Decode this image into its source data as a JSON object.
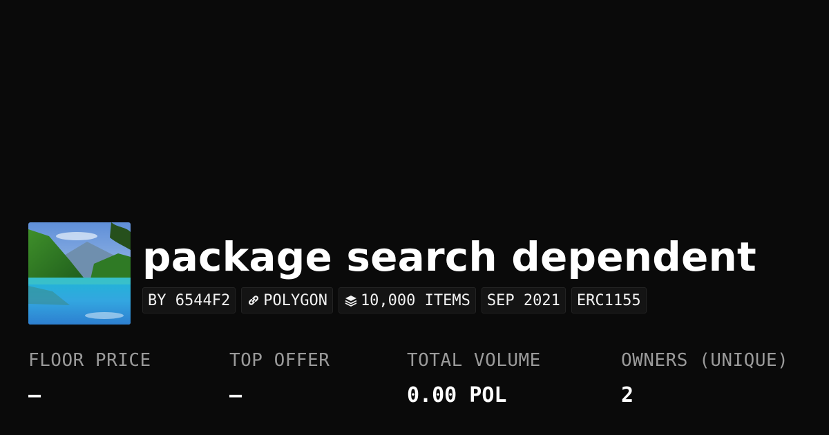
{
  "collection": {
    "title": "package search dependent",
    "thumbnail_icon": "landscape-lake-image"
  },
  "chips": [
    {
      "label": "BY 6544F2",
      "icon": ""
    },
    {
      "label": "POLYGON",
      "icon": "chain-link-icon"
    },
    {
      "label": "10,000 ITEMS",
      "icon": "layers-icon"
    },
    {
      "label": "SEP 2021",
      "icon": ""
    },
    {
      "label": "ERC1155",
      "icon": ""
    }
  ],
  "stats": [
    {
      "label": "FLOOR PRICE",
      "value": "—"
    },
    {
      "label": "TOP OFFER",
      "value": "—"
    },
    {
      "label": "TOTAL VOLUME",
      "value": "0.00 POL"
    },
    {
      "label": "OWNERS (UNIQUE)",
      "value": "2"
    }
  ],
  "colors": {
    "background": "#0a0a0a",
    "text": "#ffffff",
    "label": "#9a9a9a",
    "chip_bg": "#141414",
    "chip_border": "#232323"
  }
}
